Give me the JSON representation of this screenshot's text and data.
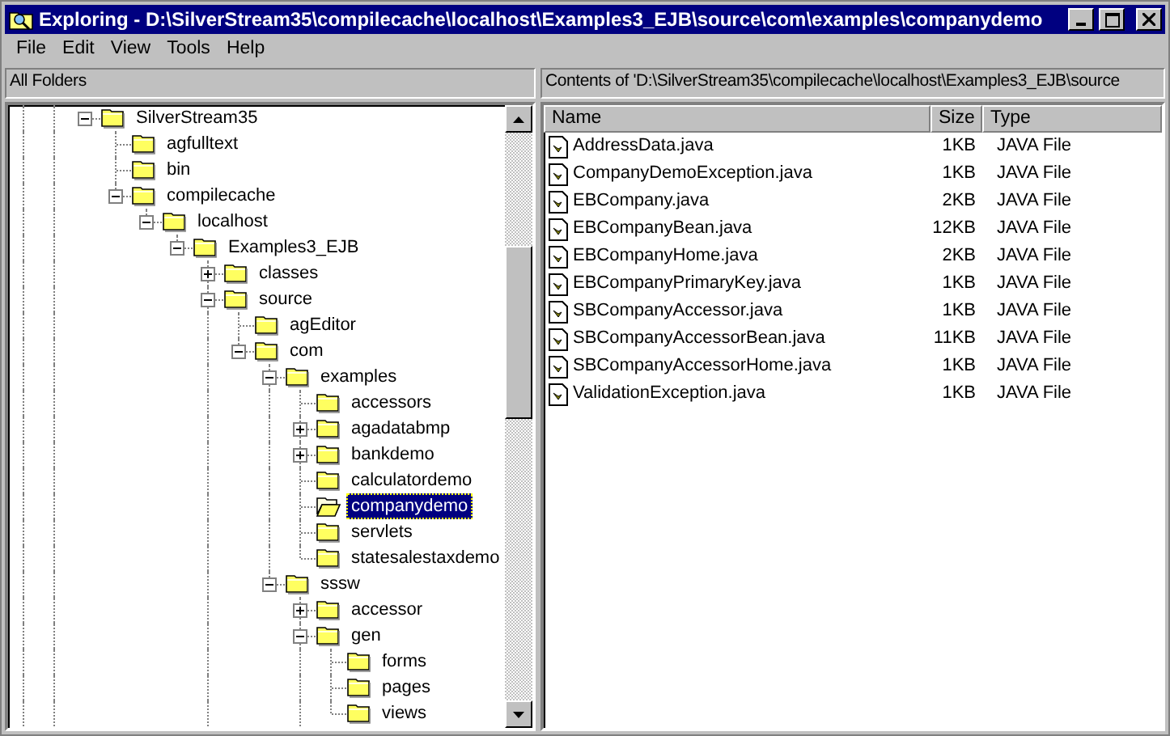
{
  "window": {
    "title": "Exploring - D:\\SilverStream35\\compilecache\\localhost\\Examples3_EJB\\source\\com\\examples\\companydemo"
  },
  "menu": [
    "File",
    "Edit",
    "View",
    "Tools",
    "Help"
  ],
  "folders_pane": {
    "title": "All Folders"
  },
  "tree": [
    {
      "label": "SilverStream35",
      "expanded": true,
      "children": [
        {
          "label": "agfulltext"
        },
        {
          "label": "bin"
        },
        {
          "label": "compilecache",
          "expanded": true,
          "children": [
            {
              "label": "localhost",
              "expanded": true,
              "children": [
                {
                  "label": "Examples3_EJB",
                  "expanded": true,
                  "children": [
                    {
                      "label": "classes",
                      "expanded": false
                    },
                    {
                      "label": "source",
                      "expanded": true,
                      "more_below": true,
                      "children": [
                        {
                          "label": "agEditor"
                        },
                        {
                          "label": "com",
                          "expanded": true,
                          "children": [
                            {
                              "label": "examples",
                              "expanded": true,
                              "children": [
                                {
                                  "label": "accessors",
                                  "selected": false
                                },
                                {
                                  "label": "agadatabmp",
                                  "expanded": false,
                                  "selected": false
                                },
                                {
                                  "label": "bankdemo",
                                  "expanded": false,
                                  "selected": false
                                },
                                {
                                  "label": "calculatordemo",
                                  "selected": false
                                },
                                {
                                  "label": "companydemo",
                                  "selected": true
                                },
                                {
                                  "label": "servlets",
                                  "selected": false
                                },
                                {
                                  "label": "statesalestaxdemo",
                                  "selected": false
                                }
                              ]
                            },
                            {
                              "label": "sssw",
                              "expanded": true,
                              "children": [
                                {
                                  "label": "accessor",
                                  "expanded": false
                                },
                                {
                                  "label": "gen",
                                  "expanded": true,
                                  "more_below": true,
                                  "children": [
                                    {
                                      "label": "forms"
                                    },
                                    {
                                      "label": "pages"
                                    },
                                    {
                                      "label": "views"
                                    }
                                  ]
                                }
                              ]
                            }
                          ]
                        }
                      ]
                    }
                  ]
                }
              ]
            }
          ]
        }
      ]
    }
  ],
  "contents_pane": {
    "title": "Contents of 'D:\\SilverStream35\\compilecache\\localhost\\Examples3_EJB\\source"
  },
  "table": {
    "columns": [
      "Name",
      "Size",
      "Type"
    ],
    "rows": [
      {
        "name": "AddressData.java",
        "size": "1KB",
        "type": "JAVA File"
      },
      {
        "name": "CompanyDemoException.java",
        "size": "1KB",
        "type": "JAVA File"
      },
      {
        "name": "EBCompany.java",
        "size": "2KB",
        "type": "JAVA File"
      },
      {
        "name": "EBCompanyBean.java",
        "size": "12KB",
        "type": "JAVA File"
      },
      {
        "name": "EBCompanyHome.java",
        "size": "2KB",
        "type": "JAVA File"
      },
      {
        "name": "EBCompanyPrimaryKey.java",
        "size": "1KB",
        "type": "JAVA File"
      },
      {
        "name": "SBCompanyAccessor.java",
        "size": "1KB",
        "type": "JAVA File"
      },
      {
        "name": "SBCompanyAccessorBean.java",
        "size": "11KB",
        "type": "JAVA File"
      },
      {
        "name": "SBCompanyAccessorHome.java",
        "size": "1KB",
        "type": "JAVA File"
      },
      {
        "name": "ValidationException.java",
        "size": "1KB",
        "type": "JAVA File"
      }
    ]
  }
}
